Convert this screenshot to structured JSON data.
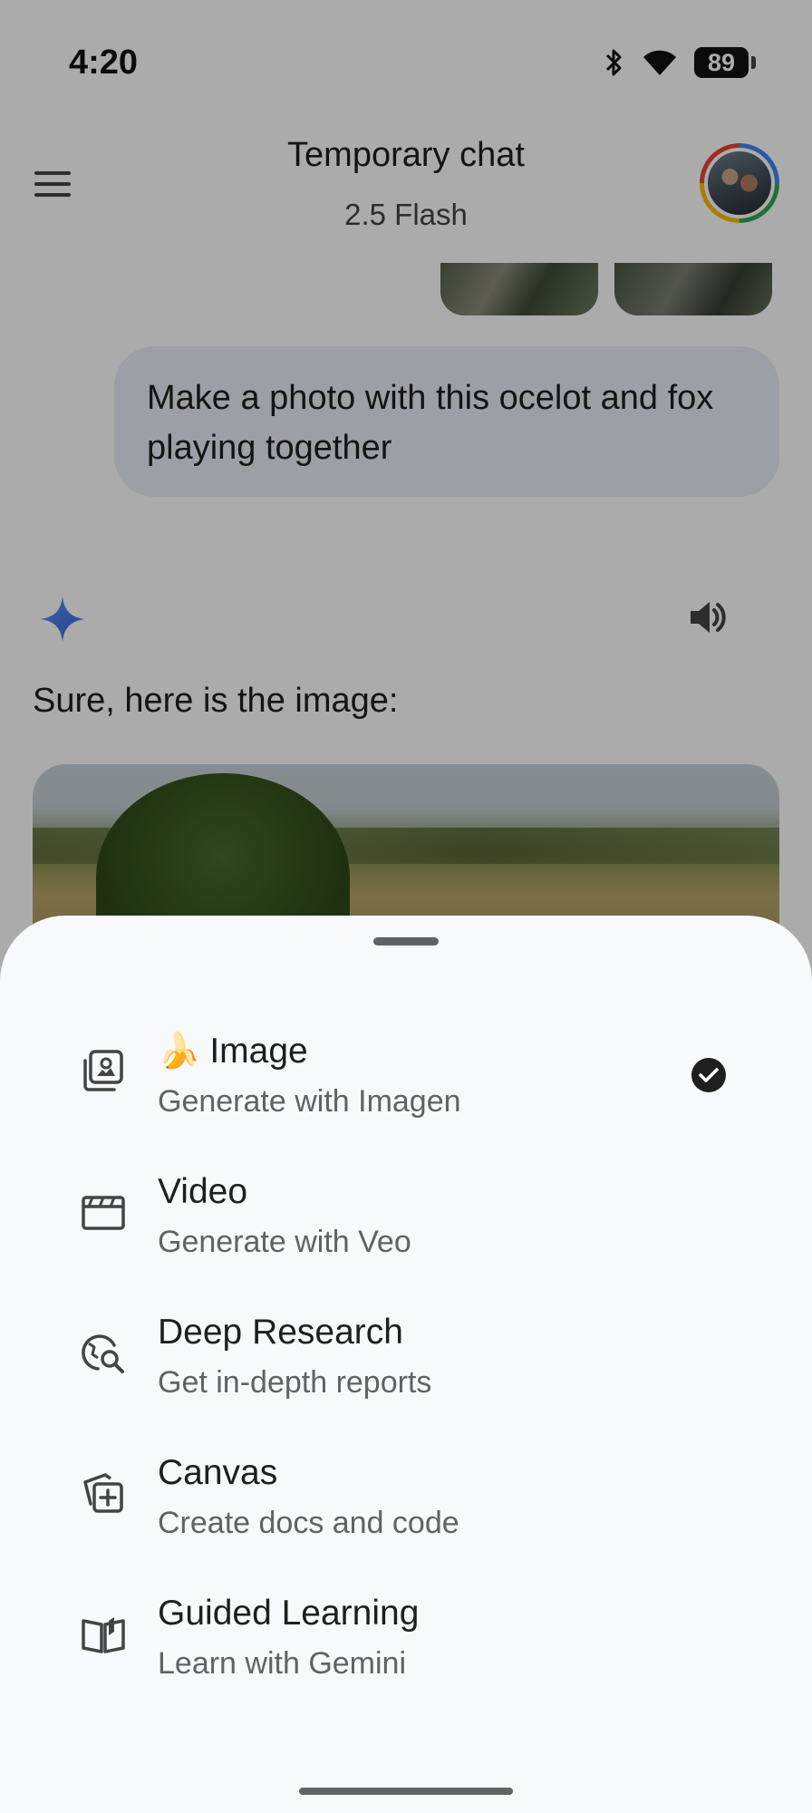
{
  "status_bar": {
    "time": "4:20",
    "battery": "89"
  },
  "header": {
    "title": "Temporary chat",
    "subtitle": "2.5 Flash"
  },
  "chat": {
    "user_message": "Make a photo with this ocelot and fox playing together",
    "response_text": "Sure, here is the image:"
  },
  "sheet": {
    "items": [
      {
        "emoji": "🍌",
        "label": "Image",
        "description": "Generate with Imagen",
        "icon": "image-stack-icon",
        "selected": true
      },
      {
        "label": "Video",
        "description": "Generate with Veo",
        "icon": "clapperboard-icon"
      },
      {
        "label": "Deep Research",
        "description": "Get in-depth reports",
        "icon": "globe-search-icon"
      },
      {
        "label": "Canvas",
        "description": "Create docs and code",
        "icon": "canvas-add-icon"
      },
      {
        "label": "Guided Learning",
        "description": "Learn with Gemini",
        "icon": "open-book-icon"
      }
    ]
  },
  "colors": {
    "sheet_bg": "#f7f9fd",
    "scrim": "rgba(0,0,0,0.33)",
    "gemini_blue": "#4a7be8"
  }
}
